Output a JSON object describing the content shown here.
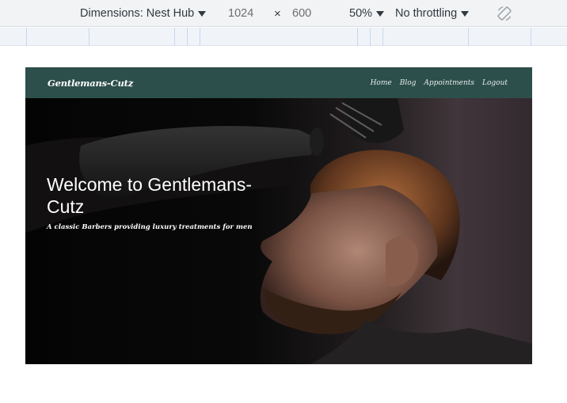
{
  "devtools": {
    "device_label": "Dimensions: Nest Hub",
    "width_value": "1024",
    "times_symbol": "×",
    "height_value": "600",
    "zoom_label": "50%",
    "throttle_label": "No throttling"
  },
  "site": {
    "brand": "Gentlemans-Cutz",
    "nav": [
      "Home",
      "Blog",
      "Appointments",
      "Logout"
    ],
    "hero_title": "Welcome to Gentlemans-Cutz",
    "hero_subtitle": "A classic Barbers providing luxury treatments for men"
  },
  "colors": {
    "navbar_bg": "#2d4f4c",
    "devtools_bg": "#f1f3f4"
  }
}
